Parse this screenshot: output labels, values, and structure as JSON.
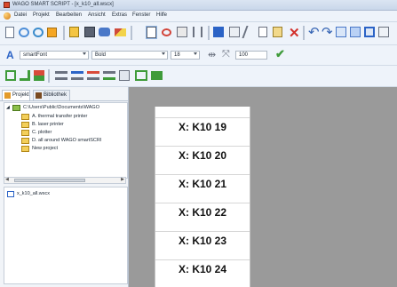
{
  "window": {
    "title": "WAGO SMART SCRIPT - [x_k10_all.wscx]"
  },
  "menu": [
    "Datei",
    "Projekt",
    "Bearbeiten",
    "Ansicht",
    "Extras",
    "Fenster",
    "Hilfe"
  ],
  "format_toolbar": {
    "font": "smartFont",
    "weight": "Bold",
    "size": "18",
    "zoom": "100"
  },
  "tabs": {
    "project": "Projekt",
    "library": "Bibliothek"
  },
  "tree": {
    "root": "C:\\Users\\Public\\Documents\\WAGO",
    "items": [
      "A. thermal transfer printer",
      "B. laser printer",
      "C. plotter",
      "D. all around WAGO smartSCRI",
      "New project"
    ]
  },
  "file_list": [
    "x_k10_all.wscx"
  ],
  "labels": [
    "X: K10 19",
    "X: K10 20",
    "X: K10 21",
    "X: K10 22",
    "X: K10 23",
    "X: K10 24"
  ],
  "colors": {
    "accent_red": "#d9482b",
    "accent_blue": "#2b63c6",
    "accent_green": "#3f9b3a",
    "doc_gray": "#9a9a9a"
  }
}
